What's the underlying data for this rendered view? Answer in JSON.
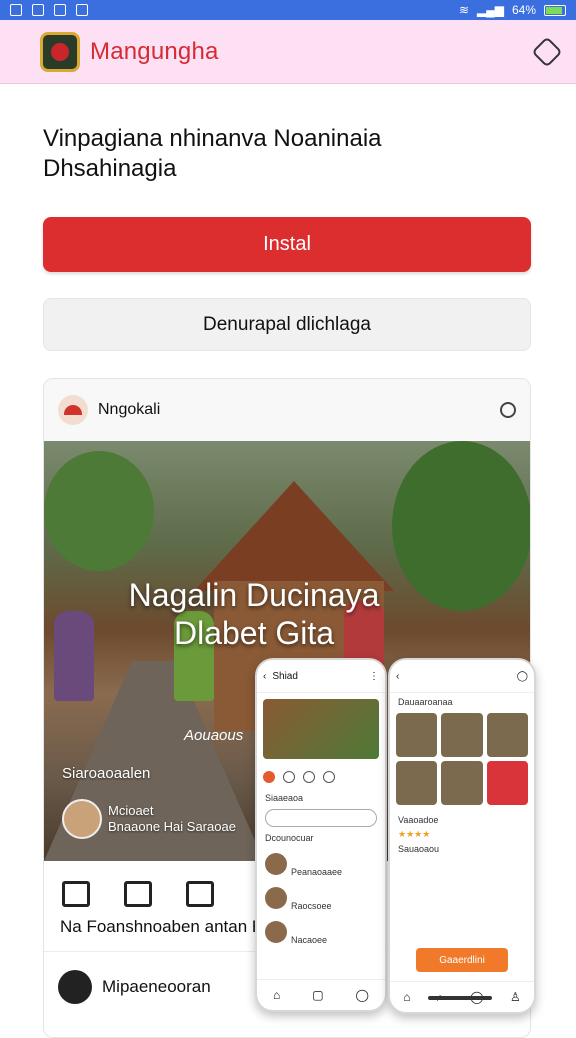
{
  "status_bar": {
    "battery_text": "64%"
  },
  "app_bar": {
    "title": "Mangungha"
  },
  "main": {
    "heading_line1": "Vinpagiana nhinanva Noaninaia",
    "heading_line2": "Dhsahinagia",
    "install_button": "Instal",
    "secondary_button": "Denurapal dlichlaga"
  },
  "card": {
    "username": "Nngokali",
    "photo_title_line1": "Nagalin Ducinaya",
    "photo_title_line2": "Dlabet Gita",
    "photo_sub": "Aouaous",
    "photo_caption": "Siaroaoaalen",
    "author_name": "Mcioaet",
    "author_sub": "Bnaaone Hai Saraoae",
    "nav_label": "Na Foanshnoaben antan B",
    "footer_text": "Mipaeneooran"
  },
  "phone_a": {
    "top_label": "Shiad",
    "line1": "Siaaeaoa",
    "line2": "Dcounocuar",
    "list_item": "Peanaoaaee",
    "list_item2": "Raocsoee",
    "list_item3": "Nacaoee"
  },
  "phone_b": {
    "header": "Dauaaroanaa",
    "line1": "Vaaoadoe",
    "rating": "★★★★",
    "line2": "Sauaoaou",
    "button": "Gaaerdlini"
  },
  "colors": {
    "status_bar": "#3b6fe0",
    "app_bar": "#fde0f4",
    "accent": "#dc2e2e",
    "title": "#d62b32"
  }
}
